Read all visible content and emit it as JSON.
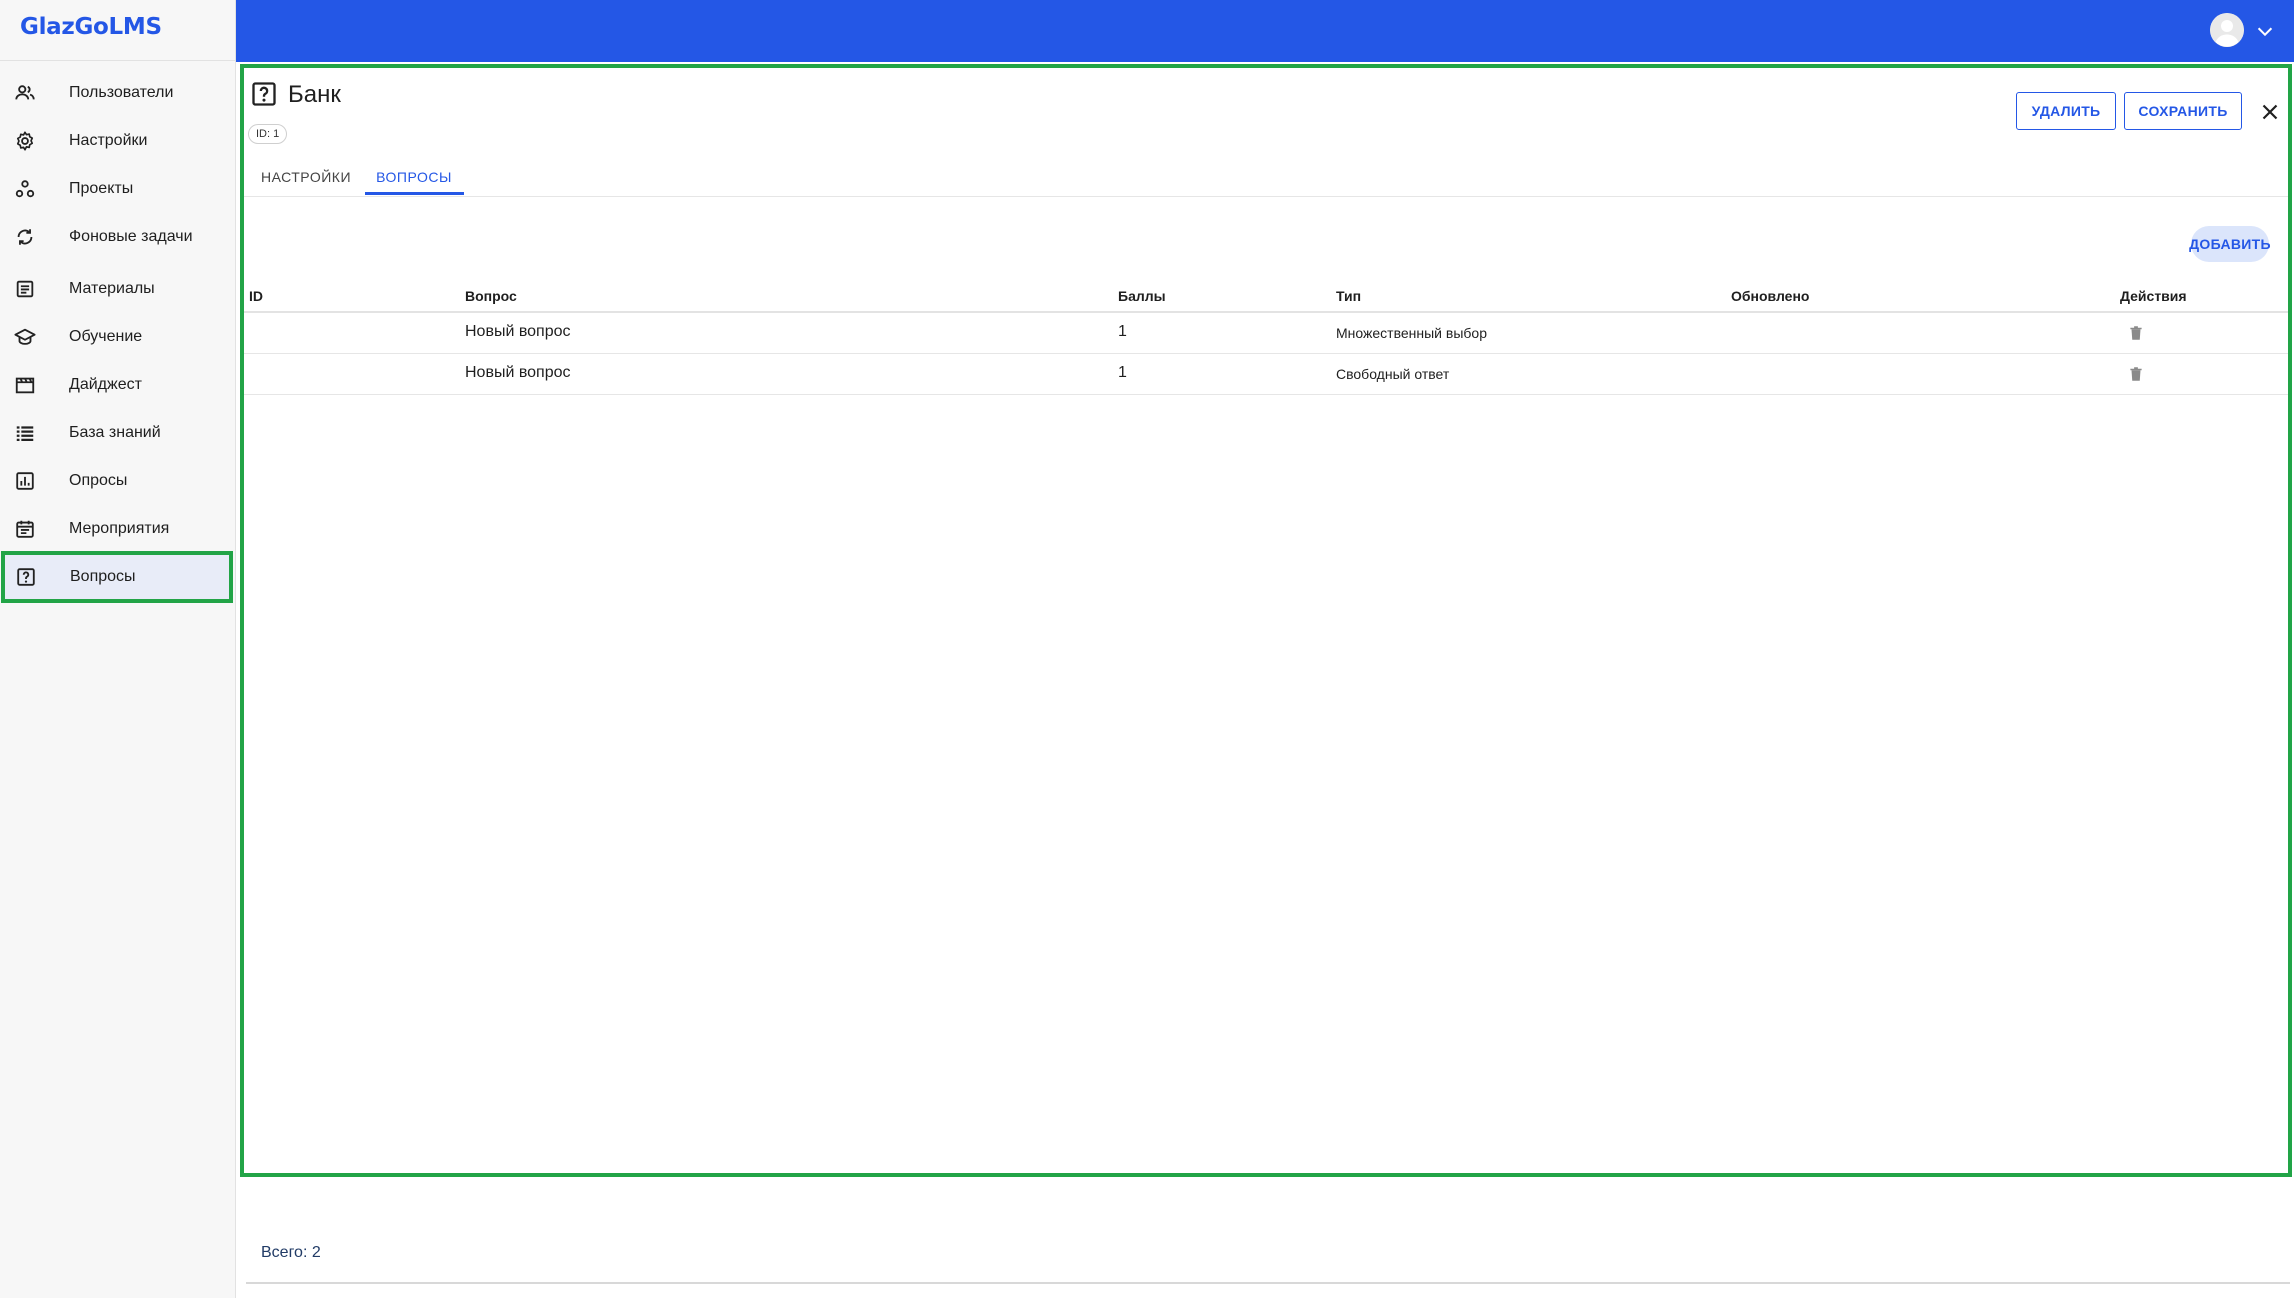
{
  "app": {
    "logo": "GlazGoLMS"
  },
  "colors": {
    "accent": "#2457e6",
    "highlight": "#22a447"
  },
  "sidebar": {
    "items": [
      {
        "label": "Пользователи",
        "icon": "users-icon"
      },
      {
        "label": "Настройки",
        "icon": "gear-icon"
      },
      {
        "label": "Проекты",
        "icon": "projects-icon"
      },
      {
        "label": "Фоновые задачи",
        "icon": "sync-icon"
      },
      {
        "label": "Материалы",
        "icon": "article-icon"
      },
      {
        "label": "Обучение",
        "icon": "school-icon"
      },
      {
        "label": "Дайджест",
        "icon": "movie-icon"
      },
      {
        "label": "База знаний",
        "icon": "list-icon"
      },
      {
        "label": "Опросы",
        "icon": "poll-icon"
      },
      {
        "label": "Мероприятия",
        "icon": "event-icon"
      },
      {
        "label": "Вопросы",
        "icon": "question-icon",
        "active": true
      }
    ]
  },
  "header": {
    "avatar_icon": "user-avatar-icon",
    "menu_icon": "chevron-down-icon"
  },
  "panel": {
    "title": "Банк",
    "title_icon": "question-icon",
    "id_chip": "ID: 1",
    "actions": {
      "delete_label": "УДАЛИТЬ",
      "save_label": "СОХРАНИТЬ",
      "close_icon": "close-icon"
    },
    "tabs": [
      {
        "label": "НАСТРОЙКИ",
        "active": false
      },
      {
        "label": "ВОПРОСЫ",
        "active": true
      }
    ],
    "add_label": "ДОБАВИТЬ",
    "table": {
      "columns": [
        "ID",
        "Вопрос",
        "Баллы",
        "Тип",
        "Обновлено",
        "Действия"
      ],
      "rows": [
        {
          "id": "",
          "question": "Новый вопрос",
          "points": "1",
          "type": "Множественный выбор",
          "updated": "",
          "action_icon": "trash-icon"
        },
        {
          "id": "",
          "question": "Новый вопрос",
          "points": "1",
          "type": "Свободный ответ",
          "updated": "",
          "action_icon": "trash-icon"
        }
      ]
    }
  },
  "footer": {
    "total": "Всего: 2"
  }
}
